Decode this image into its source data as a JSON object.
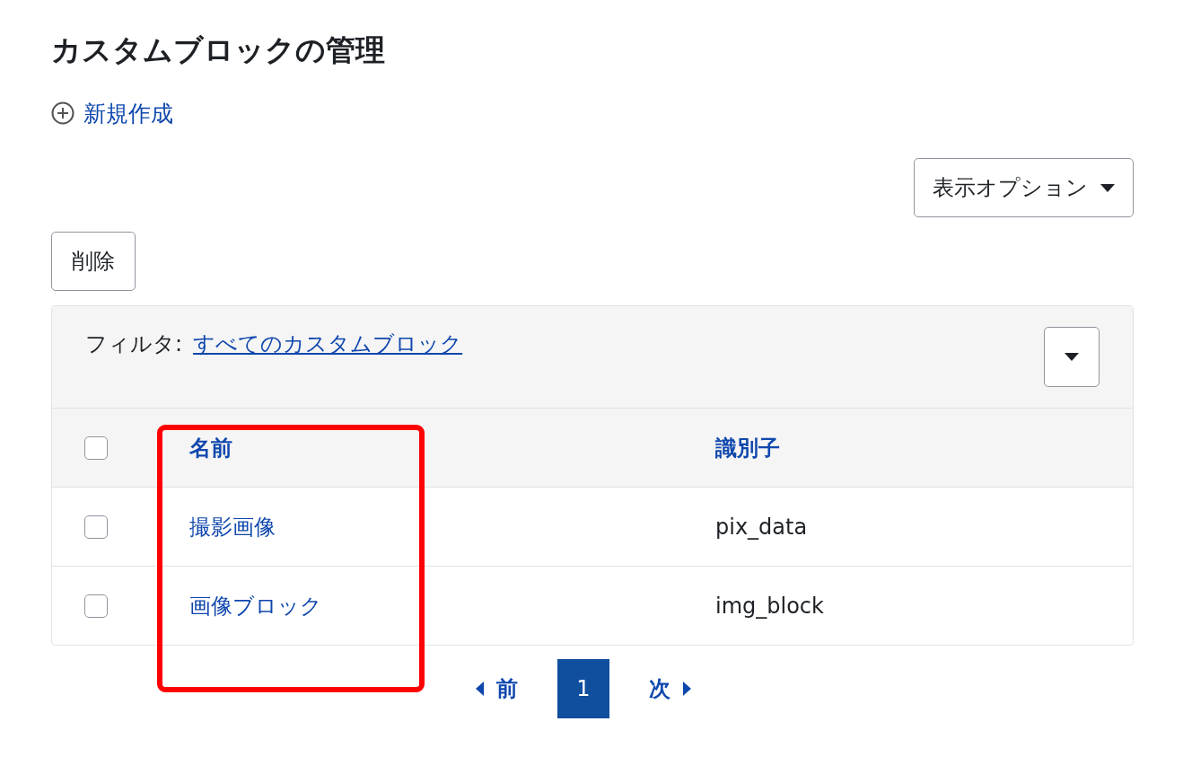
{
  "title": "カスタムブロックの管理",
  "new_link": {
    "label": "新規作成"
  },
  "display_options": {
    "label": "表示オプション"
  },
  "delete_button": {
    "label": "削除"
  },
  "filter": {
    "label": "フィルタ:",
    "value": "すべてのカスタムブロック"
  },
  "table": {
    "select_all": {
      "checked": false
    },
    "columns": [
      "名前",
      "識別子"
    ],
    "rows": [
      {
        "name": "撮影画像",
        "identifier": "pix_data",
        "checked": false
      },
      {
        "name": "画像ブロック",
        "identifier": "img_block",
        "checked": false
      }
    ]
  },
  "pagination": {
    "prev": "前",
    "next": "次",
    "pages": [
      {
        "label": "1",
        "selected": true
      }
    ]
  }
}
